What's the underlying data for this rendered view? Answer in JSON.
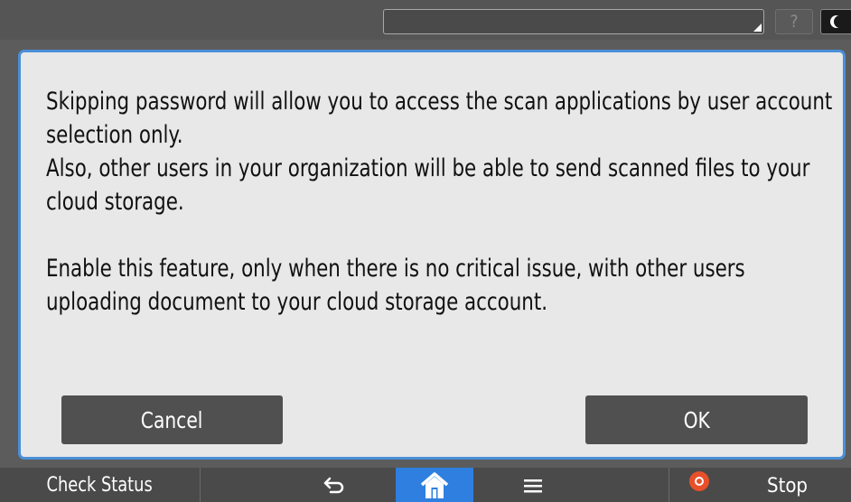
{
  "topbar": {
    "help_label": "?"
  },
  "dialog": {
    "line1": "Skipping password will allow you to access the scan applications by user account selection only.",
    "line2": "Also, other users in your organization will be able to send scanned files to your cloud storage.",
    "line3": "Enable this feature, only when there is no critical issue, with other users uploading document to your cloud storage account.",
    "cancel_label": "Cancel",
    "ok_label": "OK"
  },
  "bottombar": {
    "check_status_label": "Check Status",
    "stop_label": "Stop",
    "home_color": "#2f7fe0",
    "stop_color": "#e8502a"
  },
  "colors": {
    "dialog_border": "#4a8fd8",
    "dialog_bg": "#e8e8e8",
    "button_bg": "#505050"
  }
}
